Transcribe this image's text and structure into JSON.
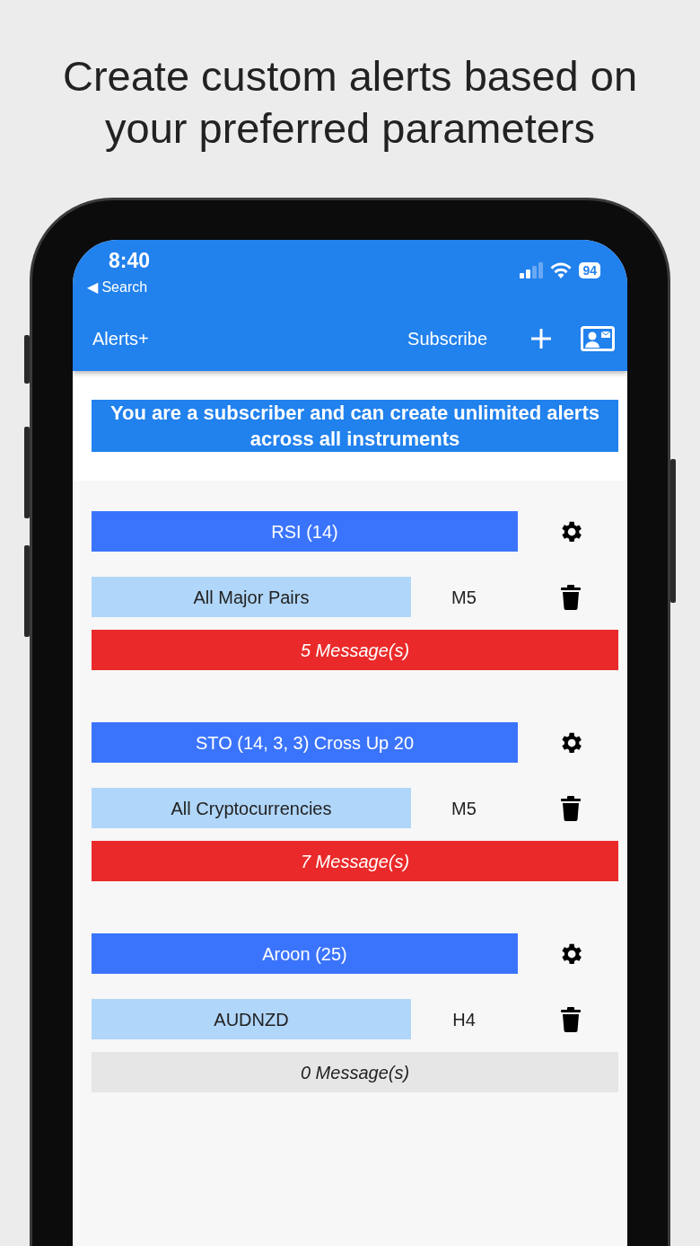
{
  "headline": "Create custom alerts based on your preferred parameters",
  "status_bar": {
    "time": "8:40",
    "back_label": "◀ Search",
    "battery": "94"
  },
  "app_bar": {
    "title": "Alerts+",
    "subscribe": "Subscribe"
  },
  "banner": "You are a subscriber and can create unlimited alerts across all instruments",
  "alerts": [
    {
      "indicator": "RSI (14)",
      "instrument": "All Major Pairs",
      "timeframe": "M5",
      "messages": "5 Message(s)",
      "has_messages": true
    },
    {
      "indicator": "STO (14, 3, 3) Cross Up 20",
      "instrument": "All Cryptocurrencies",
      "timeframe": "M5",
      "messages": "7 Message(s)",
      "has_messages": true
    },
    {
      "indicator": "Aroon (25)",
      "instrument": "AUDNZD",
      "timeframe": "H4",
      "messages": "0 Message(s)",
      "has_messages": false
    }
  ]
}
